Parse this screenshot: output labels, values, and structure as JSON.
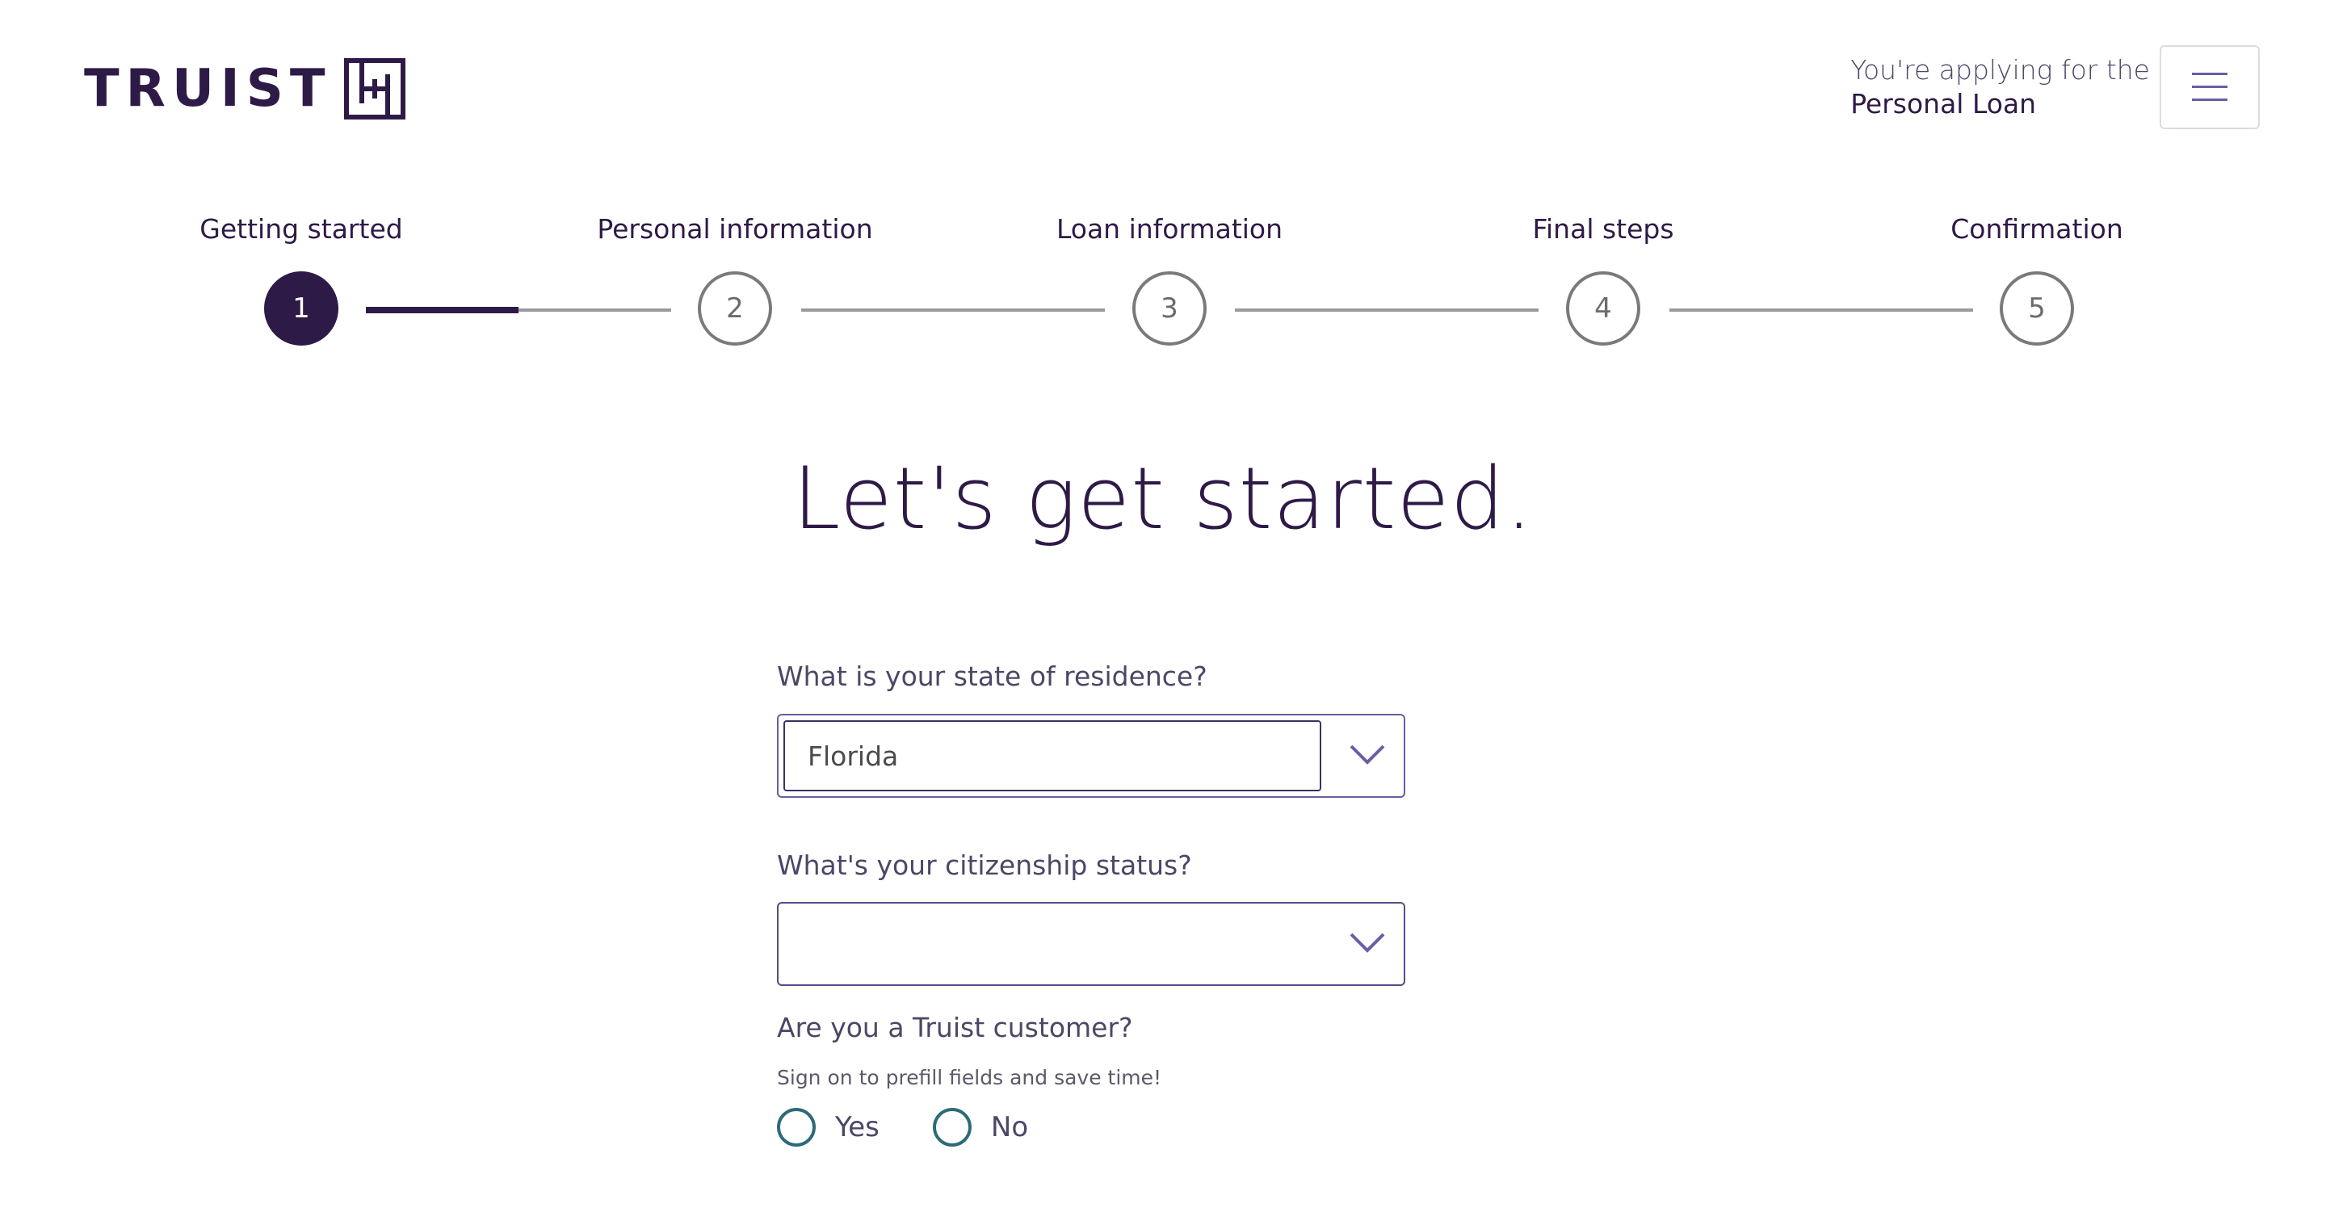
{
  "header": {
    "logo_text": "TRUIST",
    "applying_line1": "You're applying for the",
    "applying_line2": "Personal Loan",
    "menu_icon": "hamburger-menu-icon"
  },
  "stepper": {
    "current_step": 1,
    "current_segment_progress": 0.5,
    "steps": [
      {
        "label": "Getting started",
        "number": "1"
      },
      {
        "label": "Personal information",
        "number": "2"
      },
      {
        "label": "Loan information",
        "number": "3"
      },
      {
        "label": "Final steps",
        "number": "4"
      },
      {
        "label": "Confirmation",
        "number": "5"
      }
    ]
  },
  "main": {
    "heading": "Let's get started."
  },
  "form": {
    "state_question": "What is your state of residence?",
    "state_value": "Florida",
    "citizenship_question": "What's your citizenship status?",
    "citizenship_value": "",
    "customer_question": "Are you a Truist customer?",
    "customer_note": "Sign on to prefill fields and save time!",
    "options": {
      "yes": "Yes",
      "no": "No"
    }
  },
  "colors": {
    "brand_purple": "#2e1a47",
    "radio_teal": "#2d6a7a",
    "chevron_purple": "#6d5ca3"
  }
}
